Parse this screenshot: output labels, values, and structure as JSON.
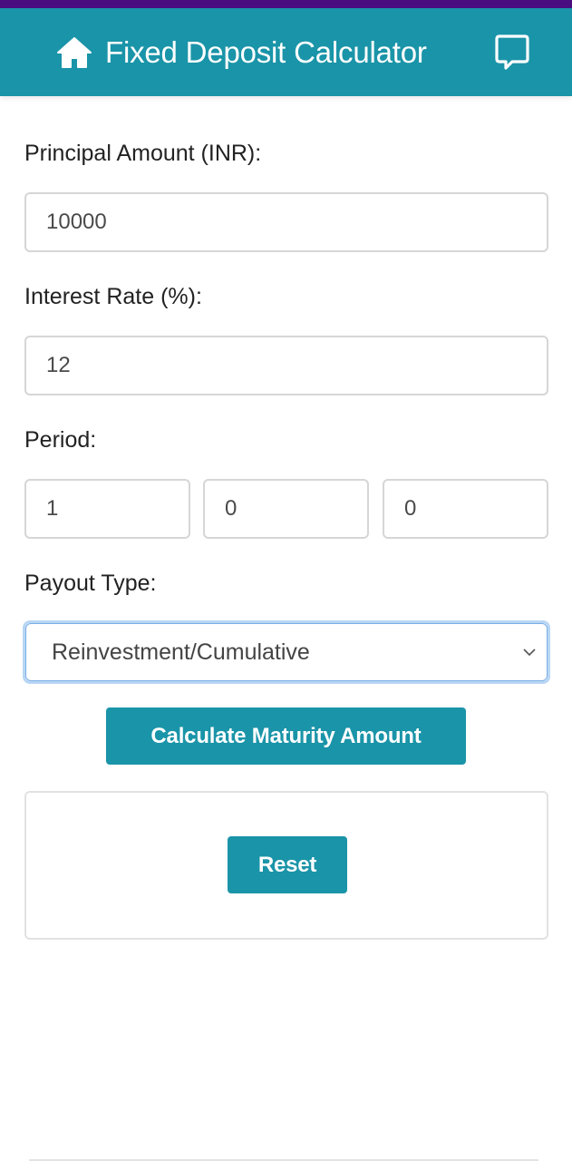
{
  "header": {
    "title": "Fixed Deposit Calculator",
    "home_icon": "home-icon",
    "feedback_icon": "chat-bubble-icon",
    "color": "#1a94a8"
  },
  "status_bar": {
    "color": "#4a0d80"
  },
  "form": {
    "principal": {
      "label": "Principal Amount (INR):",
      "value": "10000"
    },
    "interest_rate": {
      "label": "Interest Rate (%):",
      "value": "12"
    },
    "period": {
      "label": "Period:",
      "years": "1",
      "months": "0",
      "days": "0"
    },
    "payout_type": {
      "label": "Payout Type:",
      "selected": "Reinvestment/Cumulative"
    },
    "calculate_label": "Calculate Maturity Amount"
  },
  "result": {
    "reset_label": "Reset"
  }
}
